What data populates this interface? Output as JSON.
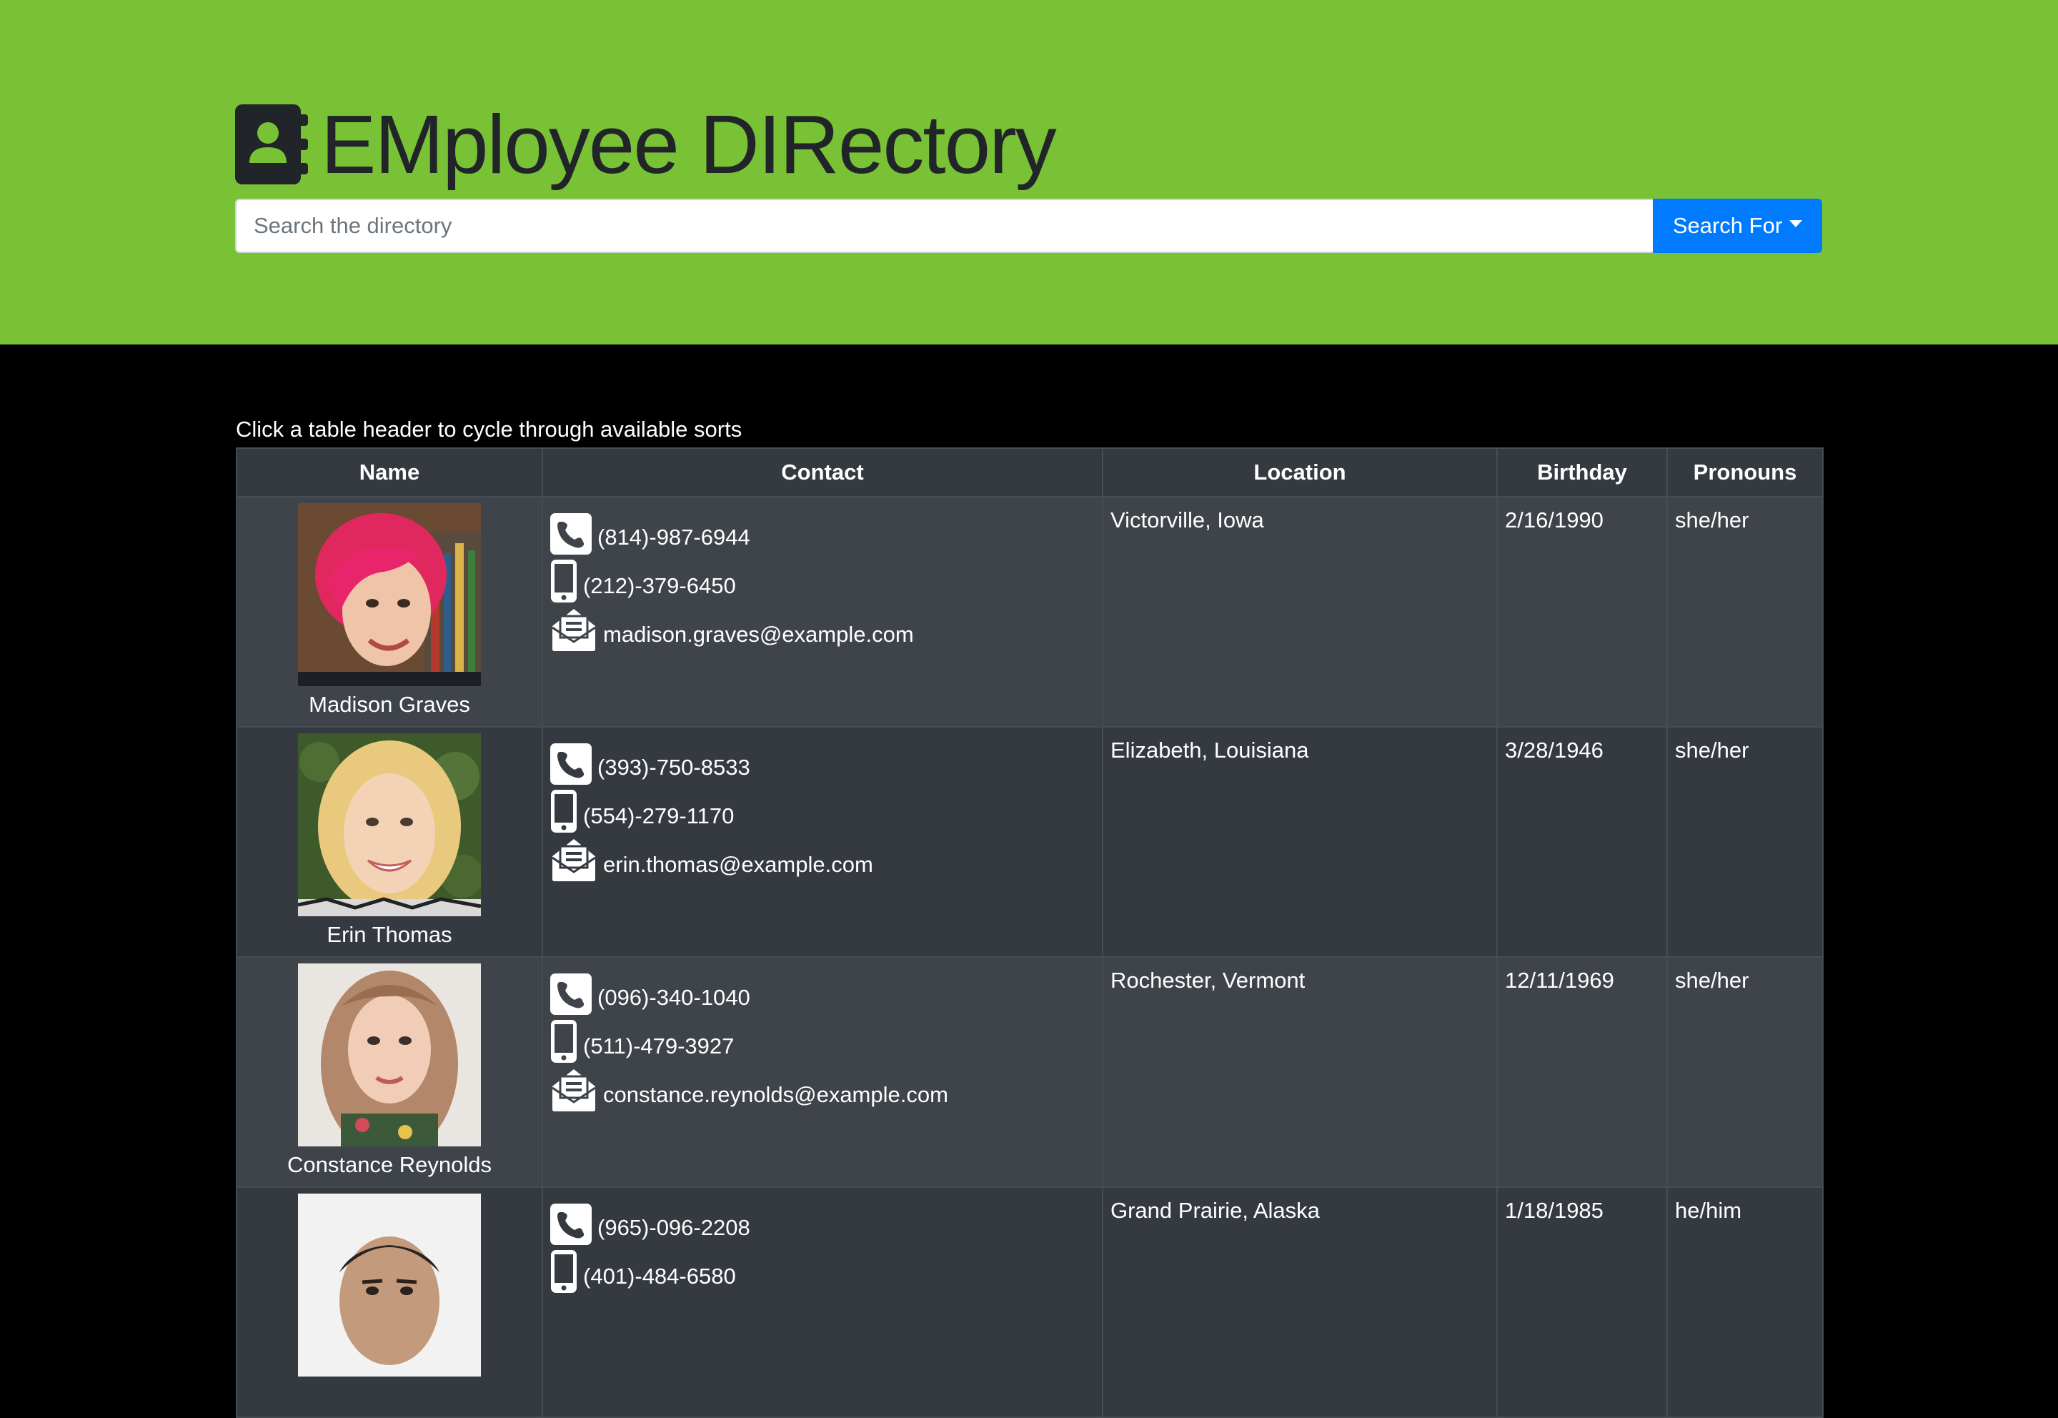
{
  "header": {
    "title": "EMployee DIRectory",
    "search_placeholder": "Search the directory",
    "search_button_label": "Search For"
  },
  "main": {
    "instructions": "Click a table header to cycle through available sorts",
    "columns": [
      "Name",
      "Contact",
      "Location",
      "Birthday",
      "Pronouns"
    ],
    "employees": [
      {
        "name": "Madison Graves",
        "phone": "(814)-987-6944",
        "cell": "(212)-379-6450",
        "email": "madison.graves@example.com",
        "location": "Victorville, Iowa",
        "birthday": "2/16/1990",
        "pronouns": "she/her"
      },
      {
        "name": "Erin Thomas",
        "phone": "(393)-750-8533",
        "cell": "(554)-279-1170",
        "email": "erin.thomas@example.com",
        "location": "Elizabeth, Louisiana",
        "birthday": "3/28/1946",
        "pronouns": "she/her"
      },
      {
        "name": "Constance Reynolds",
        "phone": "(096)-340-1040",
        "cell": "(511)-479-3927",
        "email": "constance.reynolds@example.com",
        "location": "Rochester, Vermont",
        "birthday": "12/11/1969",
        "pronouns": "she/her"
      },
      {
        "name": "",
        "phone": "(965)-096-2208",
        "cell": "(401)-484-6580",
        "email": "",
        "location": "Grand Prairie, Alaska",
        "birthday": "1/18/1985",
        "pronouns": "he/him"
      }
    ]
  },
  "colors": {
    "header_bg": "#79c135",
    "title_text": "#212529",
    "search_button": "#007bff",
    "page_bg": "#000000",
    "table_row_odd": "#3e444a",
    "table_row_even": "#343a40",
    "table_border": "#454d55"
  },
  "icons": {
    "title": "address-book-icon",
    "phone": "phone-icon",
    "cell": "mobile-phone-icon",
    "email": "envelope-open-text-icon",
    "dropdown": "caret-down-icon"
  }
}
